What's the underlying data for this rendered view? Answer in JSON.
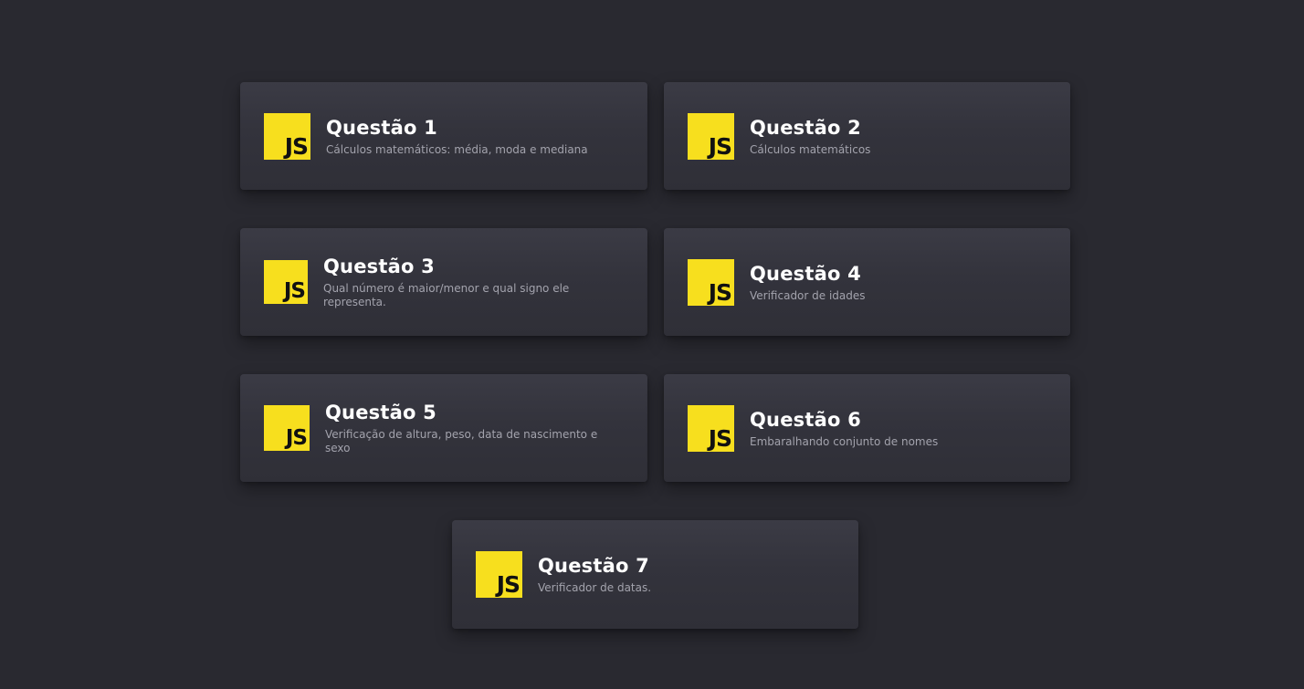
{
  "cards": [
    {
      "title": "Questão 1",
      "description": "Cálculos matemáticos: média, moda e mediana",
      "icon": "javascript-icon",
      "icon_label": "JS"
    },
    {
      "title": "Questão 2",
      "description": "Cálculos matemáticos",
      "icon": "javascript-icon",
      "icon_label": "JS"
    },
    {
      "title": "Questão 3",
      "description": "Qual número é maior/menor e qual signo ele representa.",
      "icon": "javascript-icon",
      "icon_label": "JS"
    },
    {
      "title": "Questão 4",
      "description": "Verificador de idades",
      "icon": "javascript-icon",
      "icon_label": "JS"
    },
    {
      "title": "Questão 5",
      "description": "Verificação de altura, peso, data de nascimento e sexo",
      "icon": "javascript-icon",
      "icon_label": "JS"
    },
    {
      "title": "Questão 6",
      "description": "Embaralhando conjunto de nomes",
      "icon": "javascript-icon",
      "icon_label": "JS"
    },
    {
      "title": "Questão 7",
      "description": "Verificador de datas.",
      "icon": "javascript-icon",
      "icon_label": "JS"
    }
  ],
  "colors": {
    "background": "#292930",
    "card": "#35353e",
    "js_yellow": "#f7df1e",
    "title": "#ffffff",
    "description": "#a3a3ad"
  }
}
